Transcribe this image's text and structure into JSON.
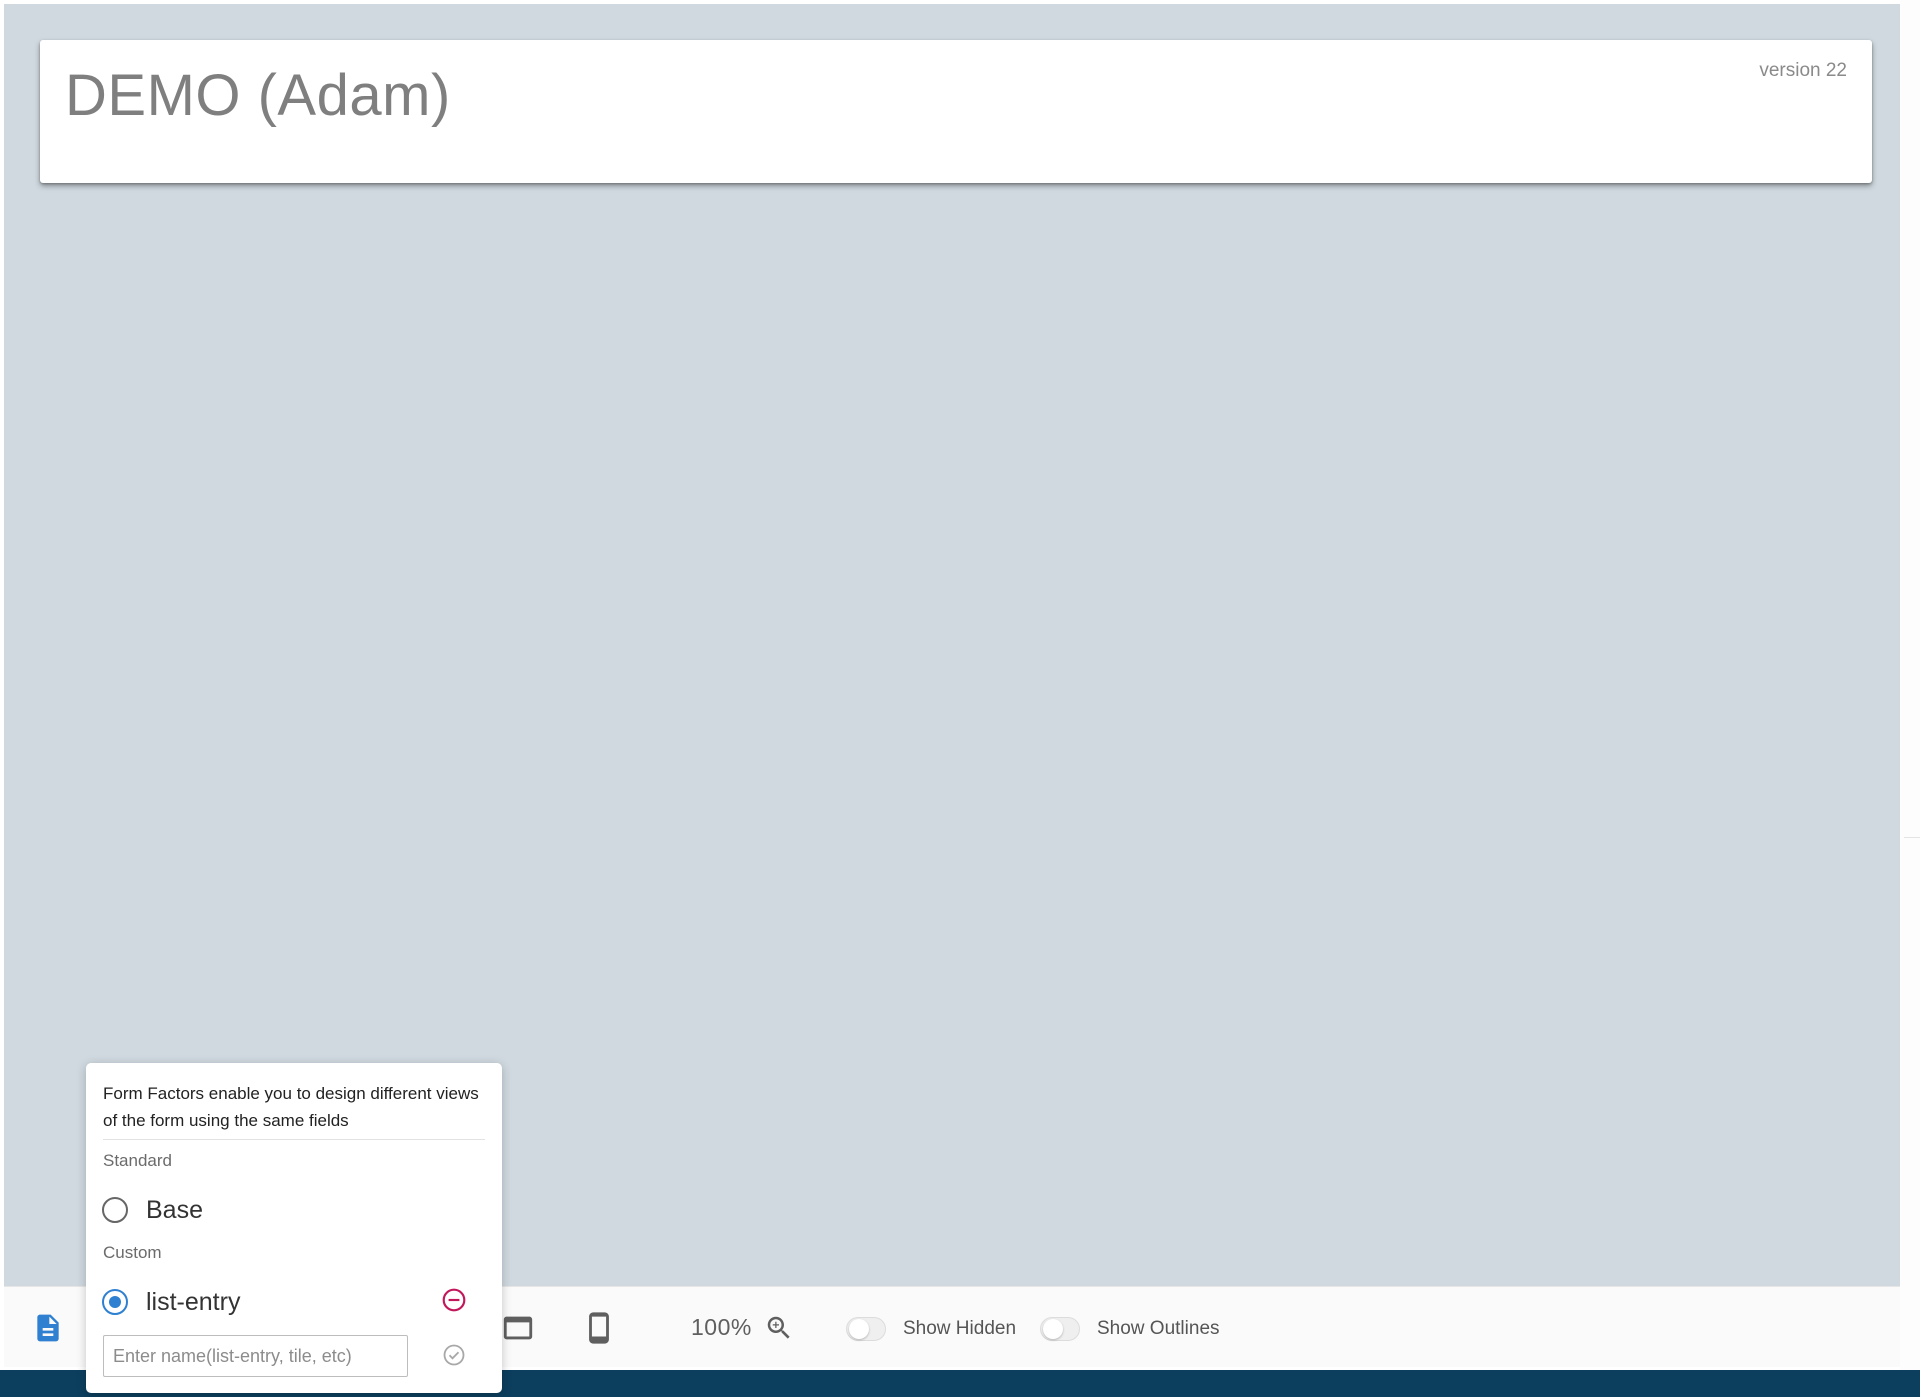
{
  "header": {
    "title": "DEMO (Adam)",
    "version": "version 22"
  },
  "toolbar": {
    "zoom_level": "100%",
    "show_hidden_label": "Show Hidden",
    "show_hidden_enabled": false,
    "show_outlines_label": "Show Outlines",
    "show_outlines_enabled": false,
    "icons": [
      "document-icon",
      "monitor-icon",
      "phone-icon",
      "zoom-in-icon"
    ]
  },
  "form_factors": {
    "description": "Form Factors enable you to design different views of the form using the same fields",
    "standard_label": "Standard",
    "standard_options": [
      {
        "label": "Base",
        "selected": false
      }
    ],
    "custom_label": "Custom",
    "custom_options": [
      {
        "label": "list-entry",
        "selected": true
      }
    ],
    "new_name_placeholder": "Enter name(list-entry, tile, etc)",
    "new_name_value": ""
  },
  "colors": {
    "canvas_background": "#cfd9df",
    "accent_blue": "#2f80d1",
    "remove_red": "#c2185b",
    "footer_strip": "#0c3f5e"
  }
}
